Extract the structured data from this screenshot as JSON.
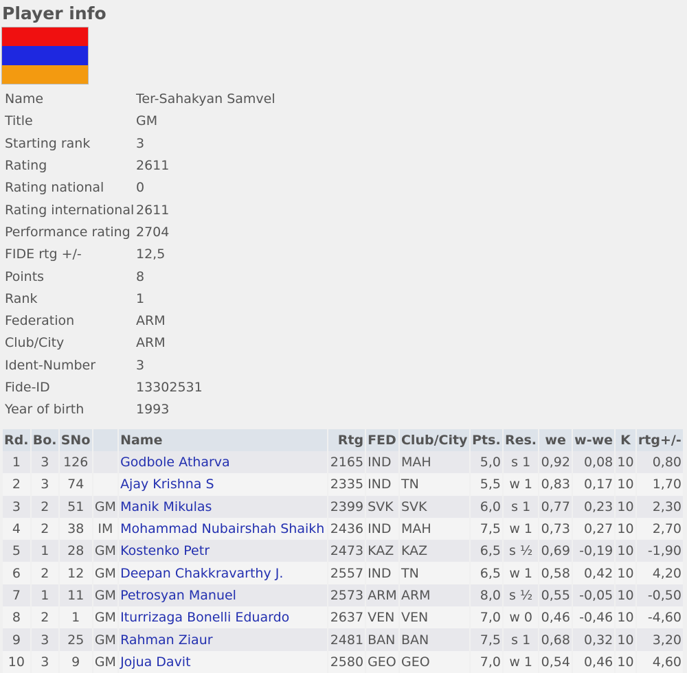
{
  "page": {
    "title": "Player info"
  },
  "flag": {
    "colors": [
      "#f01010",
      "#1e28e0",
      "#f39a10"
    ]
  },
  "info": [
    {
      "label": "Name",
      "value": "Ter-Sahakyan Samvel"
    },
    {
      "label": "Title",
      "value": "GM"
    },
    {
      "label": "Starting rank",
      "value": "3"
    },
    {
      "label": "Rating",
      "value": "2611"
    },
    {
      "label": "Rating national",
      "value": "0"
    },
    {
      "label": "Rating international",
      "value": "2611"
    },
    {
      "label": "Performance rating",
      "value": "2704"
    },
    {
      "label": "FIDE rtg +/-",
      "value": "12,5"
    },
    {
      "label": "Points",
      "value": "8"
    },
    {
      "label": "Rank",
      "value": "1"
    },
    {
      "label": "Federation",
      "value": "ARM"
    },
    {
      "label": "Club/City",
      "value": "ARM"
    },
    {
      "label": "Ident-Number",
      "value": "3"
    },
    {
      "label": "Fide-ID",
      "value": "13302531"
    },
    {
      "label": "Year of birth",
      "value": "1993"
    }
  ],
  "results": {
    "headers": [
      "Rd.",
      "Bo.",
      "SNo",
      "",
      "Name",
      "Rtg",
      "FED",
      "Club/City",
      "Pts.",
      "Res.",
      "we",
      "w-we",
      "K",
      "rtg+/-"
    ],
    "rows": [
      [
        "1",
        "3",
        "126",
        "",
        "Godbole Atharva",
        "2165",
        "IND",
        "MAH",
        "5,0",
        "s 1",
        "0,92",
        "0,08",
        "10",
        "0,80"
      ],
      [
        "2",
        "3",
        "74",
        "",
        "Ajay Krishna S",
        "2335",
        "IND",
        "TN",
        "5,5",
        "w 1",
        "0,83",
        "0,17",
        "10",
        "1,70"
      ],
      [
        "3",
        "2",
        "51",
        "GM",
        "Manik Mikulas",
        "2399",
        "SVK",
        "SVK",
        "6,0",
        "s 1",
        "0,77",
        "0,23",
        "10",
        "2,30"
      ],
      [
        "4",
        "2",
        "38",
        "IM",
        "Mohammad Nubairshah Shaikh",
        "2436",
        "IND",
        "MAH",
        "7,5",
        "w 1",
        "0,73",
        "0,27",
        "10",
        "2,70"
      ],
      [
        "5",
        "1",
        "28",
        "GM",
        "Kostenko Petr",
        "2473",
        "KAZ",
        "KAZ",
        "6,5",
        "s ½",
        "0,69",
        "-0,19",
        "10",
        "-1,90"
      ],
      [
        "6",
        "2",
        "12",
        "GM",
        "Deepan Chakkravarthy J.",
        "2557",
        "IND",
        "TN",
        "6,5",
        "w 1",
        "0,58",
        "0,42",
        "10",
        "4,20"
      ],
      [
        "7",
        "1",
        "11",
        "GM",
        "Petrosyan Manuel",
        "2573",
        "ARM",
        "ARM",
        "8,0",
        "s ½",
        "0,55",
        "-0,05",
        "10",
        "-0,50"
      ],
      [
        "8",
        "2",
        "1",
        "GM",
        "Iturrizaga Bonelli Eduardo",
        "2637",
        "VEN",
        "VEN",
        "7,0",
        "w 0",
        "0,46",
        "-0,46",
        "10",
        "-4,60"
      ],
      [
        "9",
        "3",
        "25",
        "GM",
        "Rahman Ziaur",
        "2481",
        "BAN",
        "BAN",
        "7,5",
        "s 1",
        "0,68",
        "0,32",
        "10",
        "3,20"
      ],
      [
        "10",
        "3",
        "9",
        "GM",
        "Jojua Davit",
        "2580",
        "GEO",
        "GEO",
        "7,0",
        "w 1",
        "0,54",
        "0,46",
        "10",
        "4,60"
      ]
    ]
  }
}
